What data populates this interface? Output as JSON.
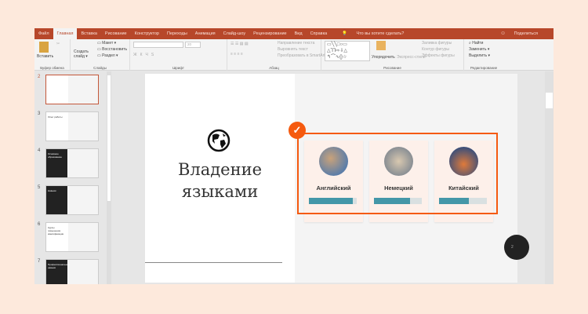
{
  "ribbon": {
    "tabs": [
      "Файл",
      "Главная",
      "Вставка",
      "Рисование",
      "Конструктор",
      "Переходы",
      "Анимация",
      "Слайд-шоу",
      "Рецензирование",
      "Вид",
      "Справка"
    ],
    "tell_me": "Что вы хотите сделать?",
    "share": "Поделиться",
    "clipboard": {
      "paste": "Вставить",
      "label": "Буфер обмена"
    },
    "slides": {
      "new_slide": "Создать",
      "new_slide2": "слайд",
      "layout": "Макет",
      "reset": "Восстановить",
      "section": "Раздел",
      "label": "Слайды"
    },
    "font": {
      "label": "Шрифт",
      "size": "20",
      "bold": "Ж",
      "italic": "К",
      "underline": "Ч",
      "strike": "S"
    },
    "paragraph": {
      "label": "Абзац",
      "text_direction": "Направление текста",
      "align_text": "Выровнять текст",
      "smartart": "Преобразовать в SmartArt"
    },
    "drawing": {
      "label": "Рисование",
      "arrange": "Упорядочить",
      "quick_styles": "Экспресс-стили",
      "fill": "Заливка фигуры",
      "outline": "Контур фигуры",
      "effects": "Эффекты фигуры"
    },
    "editing": {
      "label": "Редактирование",
      "find": "Найти",
      "replace": "Заменить",
      "select": "Выделить"
    }
  },
  "thumbnails": [
    {
      "num": "2",
      "selected": true
    },
    {
      "num": "3",
      "title": "Опыт работы"
    },
    {
      "num": "4",
      "title": "Основное образование"
    },
    {
      "num": "5",
      "title": "Навыки"
    },
    {
      "num": "6",
      "title": "Курсы повышения квалификации"
    },
    {
      "num": "7",
      "title": "Профессиональные навыки"
    }
  ],
  "slide": {
    "title_line1": "Владение",
    "title_line2": "языками",
    "icon": "globe-icon",
    "page": "2",
    "languages": [
      {
        "name": "Английский",
        "level": 0.92
      },
      {
        "name": "Немецкий",
        "level": 0.76
      },
      {
        "name": "Китайский",
        "level": 0.62
      }
    ]
  },
  "colors": {
    "accent": "#b7472a",
    "highlight": "#f55a0f",
    "bar": "#4497a8"
  }
}
